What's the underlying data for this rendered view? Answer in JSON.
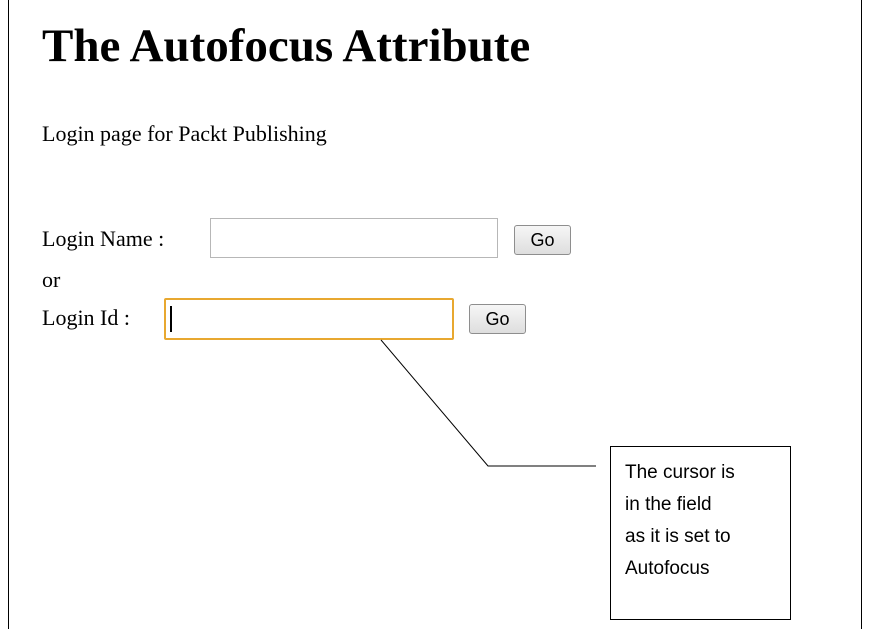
{
  "page": {
    "title": "The Autofocus Attribute",
    "subtitle": "Login page for Packt Publishing"
  },
  "form": {
    "login_name_label": "Login Name :",
    "login_name_value": "",
    "separator": "or",
    "login_id_label": "Login Id :",
    "login_id_value": "",
    "login_id_focused": true,
    "go_label": "Go"
  },
  "callout": {
    "lines": [
      "The cursor is",
      "in the field",
      "as it is set to",
      "Autofocus"
    ]
  },
  "colors": {
    "focus_border": "#e8a830",
    "field_border": "#b7b7b7"
  }
}
